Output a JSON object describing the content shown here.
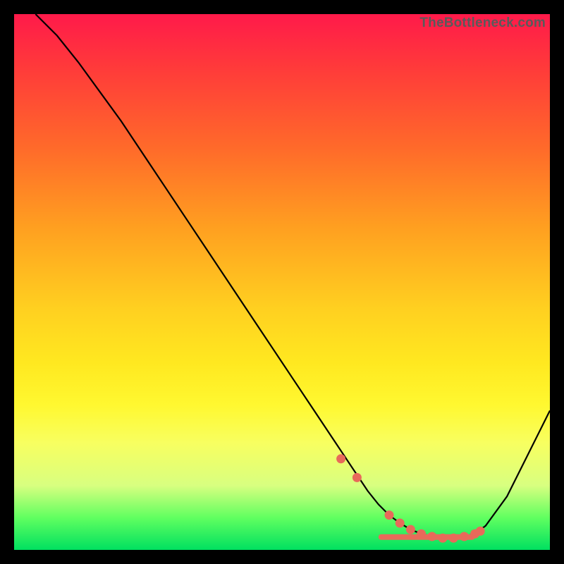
{
  "watermark": "TheBottleneck.com",
  "chart_data": {
    "type": "line",
    "title": "",
    "xlabel": "",
    "ylabel": "",
    "xlim": [
      0,
      100
    ],
    "ylim": [
      0,
      100
    ],
    "grid": false,
    "legend": false,
    "series": [
      {
        "name": "curve",
        "x": [
          4,
          8,
          12,
          16,
          20,
          24,
          28,
          32,
          36,
          40,
          44,
          48,
          52,
          56,
          60,
          62,
          64,
          66,
          68,
          70,
          72,
          74,
          76,
          78,
          80,
          82,
          84,
          86,
          88,
          92,
          96,
          100
        ],
        "y": [
          100,
          96,
          91,
          85.5,
          80,
          74,
          68,
          62,
          56,
          50,
          44,
          38,
          32,
          26,
          20,
          17,
          14,
          11,
          8.5,
          6.5,
          5,
          3.8,
          3,
          2.5,
          2.2,
          2.2,
          2.5,
          3,
          4.5,
          10,
          18,
          26
        ]
      }
    ],
    "markers": {
      "name": "highlight-dots",
      "x": [
        61,
        64,
        70,
        72,
        74,
        76,
        78,
        80,
        82,
        84,
        86,
        87
      ],
      "y": [
        17,
        13.5,
        6.5,
        5,
        3.8,
        3,
        2.5,
        2.2,
        2.2,
        2.5,
        3,
        3.5
      ]
    },
    "bar_markers": {
      "x_start": 68,
      "x_end": 86,
      "y": 2.4
    }
  }
}
